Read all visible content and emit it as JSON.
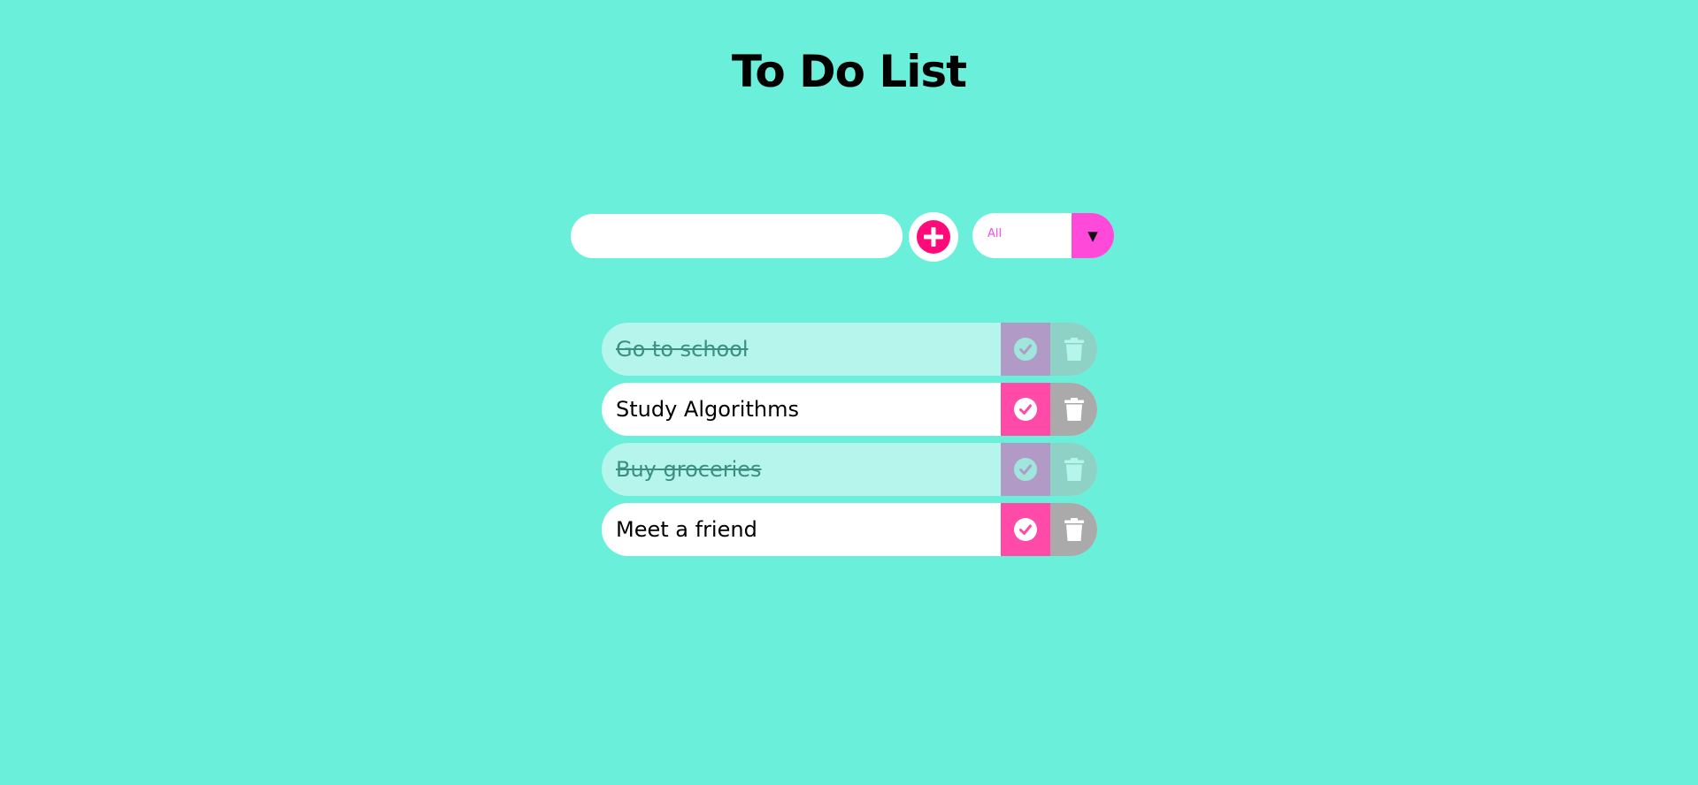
{
  "header": {
    "title": "To Do List"
  },
  "form": {
    "input_value": "",
    "input_placeholder": "",
    "add_icon": "plus-circle-icon",
    "filter": {
      "selected": "All",
      "arrow_glyph": "▼"
    }
  },
  "todos": [
    {
      "text": "Go to school",
      "completed": true
    },
    {
      "text": "Study Algorithms",
      "completed": false
    },
    {
      "text": "Buy groceries",
      "completed": true
    },
    {
      "text": "Meet a friend",
      "completed": false
    }
  ],
  "icons": {
    "complete": "check-circle-icon",
    "delete": "trash-icon"
  },
  "colors": {
    "background": "#6aefdb",
    "accent_pink": "#ff0a78",
    "filter_pink": "#ff4ad9",
    "complete_button": "#ff4aa8",
    "trash_button": "#aaaaaa",
    "completed_row": "#b6f5eb"
  }
}
